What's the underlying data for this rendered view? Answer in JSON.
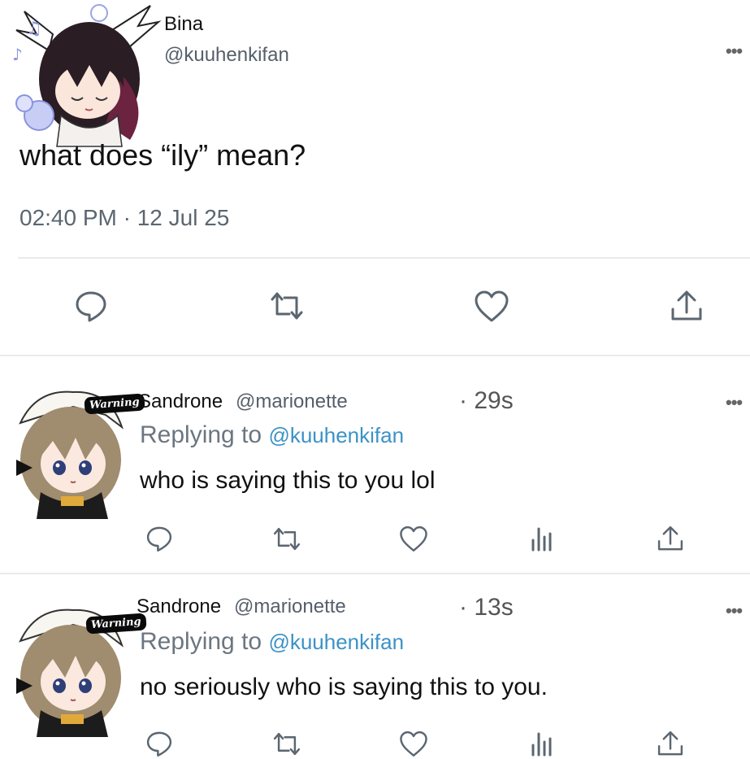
{
  "main_tweet": {
    "name": "Bina",
    "handle": "@kuuhenkifan",
    "text": "what does “ily” mean?",
    "timestamp": "02:40 PM · 12 Jul 25",
    "more_icon": "more-dots-icon",
    "actions": [
      "reply-icon",
      "retweet-icon",
      "like-icon",
      "share-icon"
    ]
  },
  "replies": [
    {
      "name": "Sandrone",
      "handle": "@marionette",
      "time": "· 29s",
      "replying_label": "Replying to",
      "replying_to": "@kuuhenkifan",
      "text": "who is saying this to you lol",
      "badge": "Warning"
    },
    {
      "name": "Sandrone",
      "handle": "@marionette",
      "time": "· 13s",
      "replying_label": "Replying to",
      "replying_to": "@kuuhenkifan",
      "text": "no seriously who is saying this to you.",
      "badge": "Warning"
    }
  ],
  "more_dots": "•••",
  "colors": {
    "mention": "#3b92c7",
    "divider": "#e8ebee",
    "icon": "#5b6670"
  }
}
